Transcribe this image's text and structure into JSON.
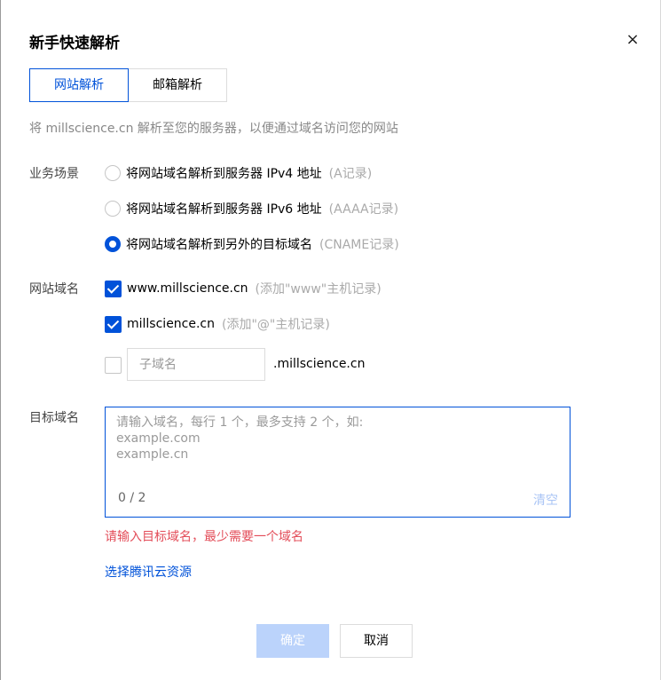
{
  "dialog": {
    "title": "新手快速解析",
    "close_label": "×"
  },
  "tabs": [
    {
      "label": "网站解析",
      "active": true
    },
    {
      "label": "邮箱解析",
      "active": false
    }
  ],
  "description": "将 millscience.cn 解析至您的服务器，以便通过域名访问您的网站",
  "scene": {
    "label": "业务场景",
    "options": [
      {
        "text": "将网站域名解析到服务器 IPv4 地址",
        "hint": "(A记录)",
        "checked": false
      },
      {
        "text": "将网站域名解析到服务器 IPv6 地址",
        "hint": "(AAAA记录)",
        "checked": false
      },
      {
        "text": "将网站域名解析到另外的目标域名",
        "hint": "(CNAME记录)",
        "checked": true
      }
    ]
  },
  "site_domain": {
    "label": "网站域名",
    "options": [
      {
        "text": "www.millscience.cn",
        "hint": "(添加\"www\"主机记录)",
        "checked": true
      },
      {
        "text": "millscience.cn",
        "hint": "(添加\"@\"主机记录)",
        "checked": true
      }
    ],
    "subdomain": {
      "placeholder": "子域名",
      "value": "",
      "suffix": ".millscience.cn",
      "checked": false
    }
  },
  "target_domain": {
    "label": "目标域名",
    "placeholder": "请输入域名，每行 1 个，最多支持 2 个，如:\nexample.com\nexample.cn",
    "value": "",
    "counter": "0 / 2",
    "clear_label": "清空",
    "error": "请输入目标域名，最少需要一个域名"
  },
  "select_resource_link": "选择腾讯云资源",
  "buttons": {
    "confirm": "确定",
    "cancel": "取消"
  },
  "colors": {
    "primary": "#0052d9",
    "error": "#e34d59",
    "disabled_button": "#bbd3fb"
  }
}
